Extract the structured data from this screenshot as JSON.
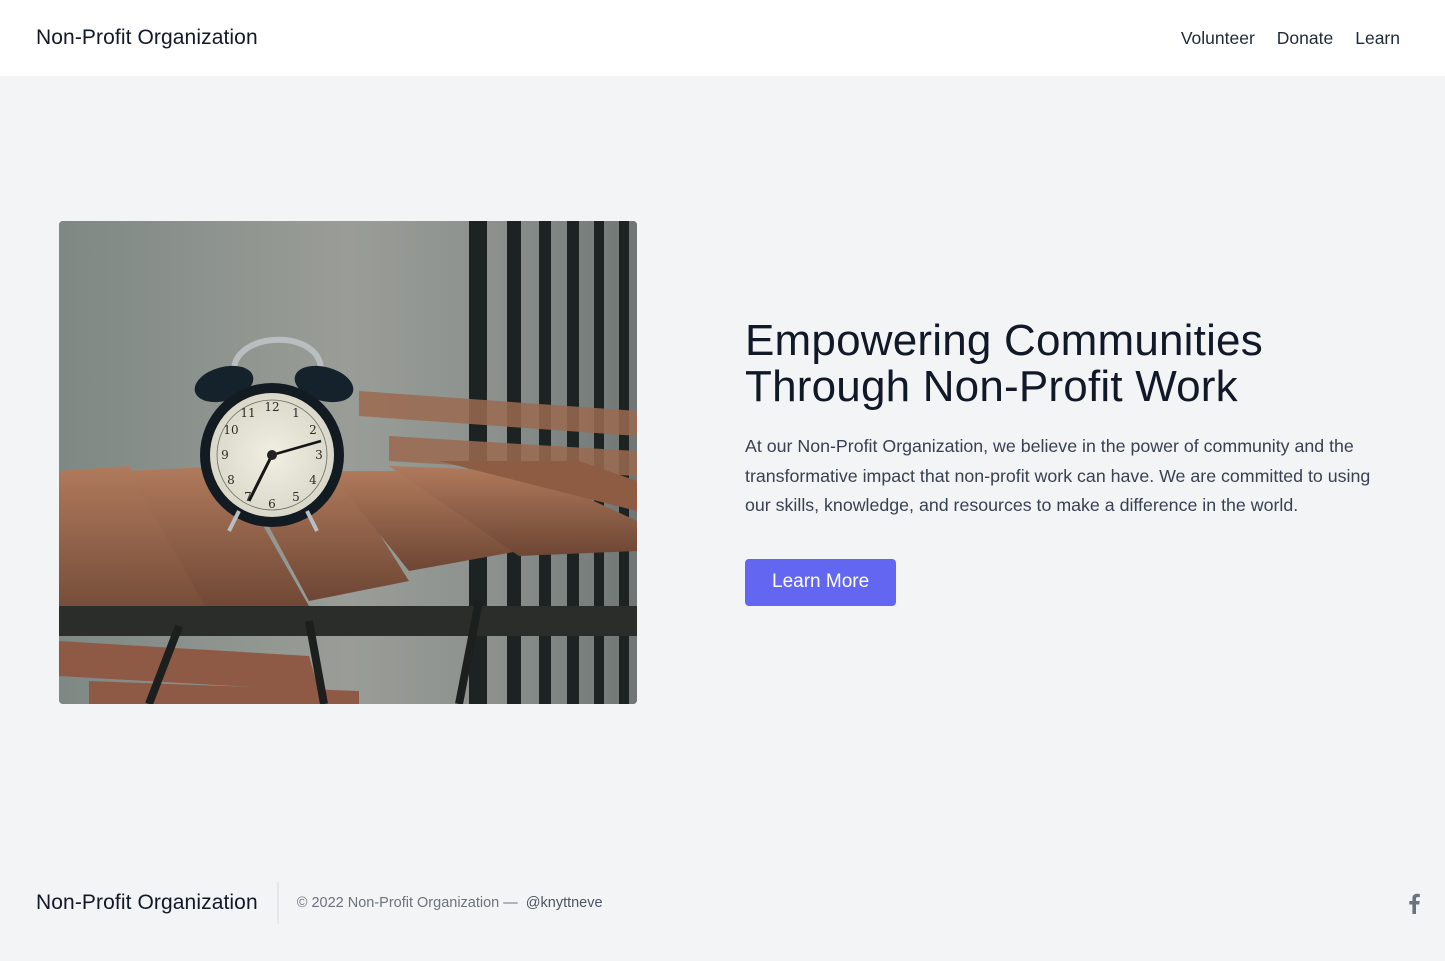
{
  "header": {
    "brand": "Non-Profit Organization",
    "nav": [
      {
        "label": "Volunteer"
      },
      {
        "label": "Donate"
      },
      {
        "label": "Learn"
      }
    ]
  },
  "hero": {
    "image_alt": "Alarm clock on a wooden slatted table",
    "title": "Empowering Communities Through Non-Profit Work",
    "description": "At our Non-Profit Organization, we believe in the power of community and the transformative impact that non-profit work can have. We are committed to using our skills, knowledge, and resources to make a difference in the world.",
    "cta_label": "Learn More"
  },
  "footer": {
    "brand": "Non-Profit Organization",
    "copyright": "© 2022 Non-Profit Organization —",
    "handle": "@knyttneve",
    "social": [
      {
        "icon": "facebook-icon"
      }
    ]
  },
  "colors": {
    "accent": "#6366f1",
    "background": "#f3f4f6",
    "header_bg": "#ffffff",
    "text_primary": "#111827",
    "text_muted": "#6b7280"
  }
}
